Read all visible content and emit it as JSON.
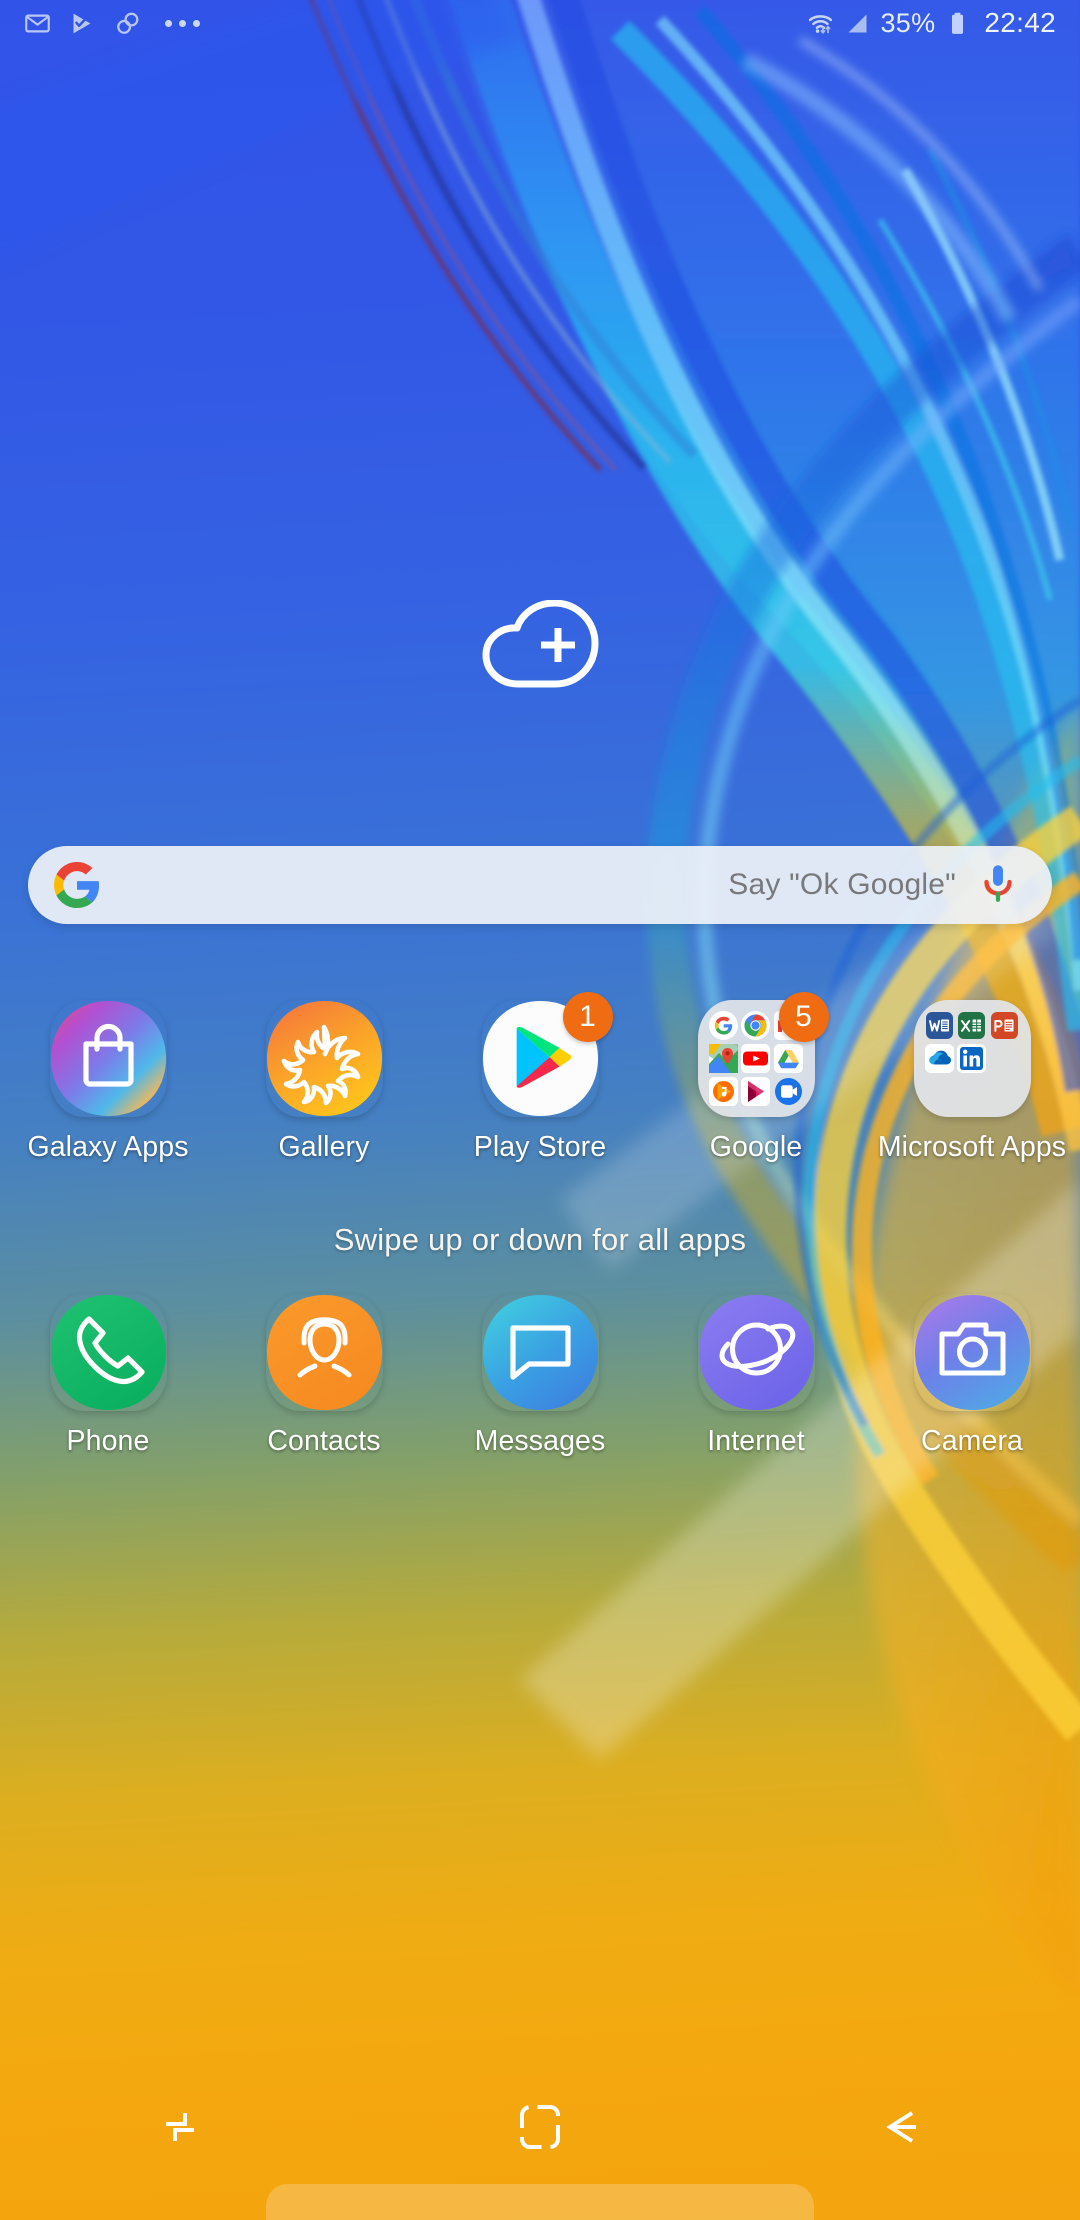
{
  "status_bar": {
    "left_icons": [
      {
        "name": "gmail-icon",
        "label": "Gmail"
      },
      {
        "name": "play-protect-icon",
        "label": "Play Protect"
      },
      {
        "name": "link-icon",
        "label": "Link sharing"
      },
      {
        "name": "more-notifications-icon",
        "label": "More notifications"
      }
    ],
    "wifi_icon": "wifi-icon",
    "signal_icon": "cellular-signal-icon",
    "battery_percent": "35%",
    "battery_icon": "battery-icon",
    "time": "22:42"
  },
  "widget": {
    "name": "add-widget-placeholder",
    "icon": "cloud-plus-icon"
  },
  "search": {
    "google_logo": "google-g-icon",
    "placeholder": "Say \"Ok Google\"",
    "mic_icon": "microphone-icon"
  },
  "colors": {
    "badge": "#ef6c12",
    "search_bg": "#edf1f8",
    "label": "#ffffff",
    "wallpaper_blue": "#3253e8",
    "wallpaper_orange": "#f3a40e"
  },
  "home_screen": {
    "apps": [
      {
        "label": "Galaxy Apps",
        "icon": "galaxy-apps-icon",
        "badge": null
      },
      {
        "label": "Gallery",
        "icon": "gallery-icon",
        "badge": null
      },
      {
        "label": "Play Store",
        "icon": "play-store-icon",
        "badge": "1"
      },
      {
        "label": "Google",
        "icon": "google-folder-icon",
        "badge": "5",
        "folder_items": [
          "Google",
          "Chrome",
          "Gmail",
          "Maps",
          "YouTube",
          "Drive",
          "Play Music",
          "Play Movies",
          "Duo"
        ]
      },
      {
        "label": "Microsoft Apps",
        "icon": "microsoft-apps-folder-icon",
        "badge": null,
        "folder_items": [
          "Word",
          "Excel",
          "PowerPoint",
          "OneDrive",
          "LinkedIn"
        ]
      }
    ],
    "swipe_hint": "Swipe up or down for all apps",
    "dock": [
      {
        "label": "Phone",
        "icon": "phone-icon"
      },
      {
        "label": "Contacts",
        "icon": "contacts-icon"
      },
      {
        "label": "Messages",
        "icon": "messages-icon"
      },
      {
        "label": "Internet",
        "icon": "internet-icon"
      },
      {
        "label": "Camera",
        "icon": "camera-icon"
      }
    ]
  },
  "nav_bar": {
    "recents": "recents-icon",
    "home": "home-icon",
    "back": "back-icon"
  }
}
